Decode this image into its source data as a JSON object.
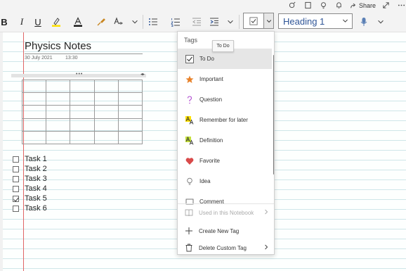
{
  "app": {
    "share_label": "Share"
  },
  "ribbon": {
    "bold": "B",
    "italic": "I",
    "underline": "U",
    "tag_selected": "☑",
    "style_value": "Heading 1"
  },
  "page": {
    "title": "Physics Notes",
    "date": "30 July 2021",
    "time": "13:30"
  },
  "tasks": [
    {
      "label": "Task 1",
      "checked": false
    },
    {
      "label": "Task 2",
      "checked": false
    },
    {
      "label": "Task 3",
      "checked": false
    },
    {
      "label": "Task 4",
      "checked": false
    },
    {
      "label": "Task 5",
      "checked": true
    },
    {
      "label": "Task 6",
      "checked": false
    }
  ],
  "tags_menu": {
    "header": "Tags",
    "tooltip": "To Do",
    "items": [
      {
        "label": "To Do",
        "icon": "checkbox-icon",
        "selected": true
      },
      {
        "label": "Important",
        "icon": "star-icon"
      },
      {
        "label": "Question",
        "icon": "question-icon"
      },
      {
        "label": "Remember for later",
        "icon": "highlight-a-icon"
      },
      {
        "label": "Definition",
        "icon": "highlight-a-green-icon"
      },
      {
        "label": "Favorite",
        "icon": "heart-icon"
      },
      {
        "label": "Idea",
        "icon": "lightbulb-icon"
      },
      {
        "label": "Comment",
        "icon": "comment-icon"
      }
    ],
    "bottom": [
      {
        "label": "Used in this Notebook",
        "icon": "book-icon",
        "disabled": true
      },
      {
        "label": "Create New Tag",
        "icon": "plus-icon"
      },
      {
        "label": "Delete Custom Tag",
        "icon": "trash-icon"
      }
    ]
  },
  "colors": {
    "highlight": "#ffe100",
    "font_color_bar": "#1a1a1a",
    "margin_line": "#e06666",
    "rule_line": "#cfe6e9",
    "star": "#e8822a",
    "question": "#b04ad0",
    "heart": "#d94a4a",
    "style_text": "#2f5597"
  }
}
